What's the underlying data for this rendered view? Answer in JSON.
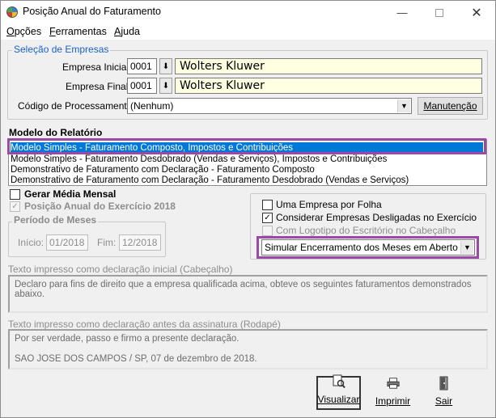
{
  "window": {
    "title": "Posição Anual do Faturamento"
  },
  "menu": [
    {
      "label": "Opções",
      "accel": "O"
    },
    {
      "label": "Ferramentas",
      "accel": "F"
    },
    {
      "label": "Ajuda",
      "accel": "A"
    }
  ],
  "selecao": {
    "legend": "Seleção de Empresas",
    "empresa_inicial_label": "Empresa Inicial",
    "empresa_inicial_code": "0001",
    "empresa_inicial_name": "Wolters Kluwer",
    "empresa_final_label": "Empresa Final",
    "empresa_final_code": "0001",
    "empresa_final_name": "Wolters Kluwer",
    "codigo_label": "Código de Processamento",
    "codigo_value": "(Nenhum)",
    "manutencao_label": "Manutenção"
  },
  "modelo": {
    "title": "Modelo do Relatório",
    "items": [
      "Modelo Simples - Faturamento Composto, Impostos e Contribuições",
      "Modelo Simples - Faturamento Desdobrado (Vendas e Serviços), Impostos e Contribuições",
      "Demonstrativo de Faturamento com Declaração - Faturamento Composto",
      "Demonstrativo de Faturamento com Declaração - Faturamento Desdobrado (Vendas e Serviços)"
    ],
    "selected_index": 0
  },
  "options_left": {
    "gerar_media_label": "Gerar Média Mensal",
    "gerar_media_checked": false,
    "posicao_anual_label": "Posição Anual do Exercício 2018",
    "posicao_anual_checked": true,
    "periodo_legend": "Período de Meses",
    "inicio_label": "Início:",
    "inicio_value": "01/2018",
    "fim_label": "Fim:",
    "fim_value": "12/2018"
  },
  "options_right": {
    "uma_empresa_label": "Uma Empresa por Folha",
    "uma_empresa_checked": false,
    "considerar_label": "Considerar Empresas Desligadas no Exercício",
    "considerar_checked": true,
    "logotipo_label": "Com Logotipo do Escritório no Cabeçalho",
    "logotipo_checked": false,
    "simular_value": "Simular Encerramento dos Meses em Aberto"
  },
  "cabecalho": {
    "label": "Texto impresso como declaração inicial (Cabeçalho)",
    "text": "Declaro para fins de direito que a empresa qualificada acima, obteve os seguintes faturamentos demonstrados abaixo."
  },
  "rodape": {
    "label": "Texto impresso como declaração antes da assinatura (Rodapé)",
    "line1": "Por ser verdade, passo e firmo a presente declaração.",
    "line2": "SAO JOSE DOS CAMPOS / SP, 07 de dezembro de 2018."
  },
  "buttons": {
    "visualizar": "Visualizar",
    "imprimir": "Imprimir",
    "sair": "Sair"
  },
  "icons": {
    "app": "app-logo-icon",
    "minimize": "minimize-icon",
    "maximize": "maximize-icon",
    "close": "close-icon",
    "visualizar": "magnifier-document-icon",
    "imprimir": "printer-icon",
    "sair": "exit-door-icon"
  },
  "colors": {
    "selection": "#0078d7",
    "highlight": "#9a4aa6",
    "input_yellow": "#ffffe1",
    "legend_blue": "#1a62c8"
  }
}
